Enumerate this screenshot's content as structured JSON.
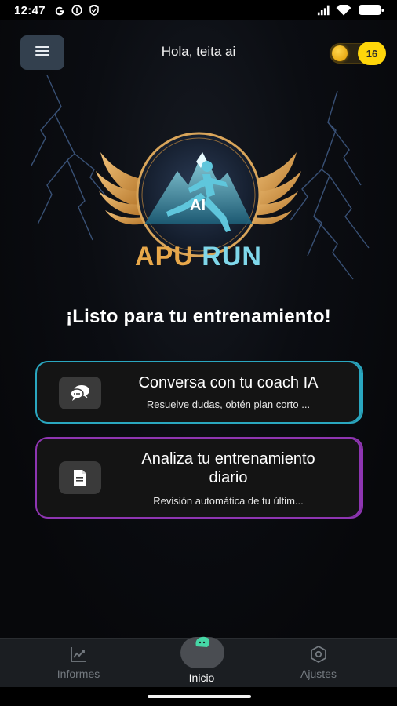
{
  "status_bar": {
    "time": "12:47",
    "left_icons": [
      "google-icon",
      "info-icon",
      "shield-icon"
    ],
    "right_icons": [
      "signal-icon",
      "wifi-icon",
      "battery-icon"
    ]
  },
  "header": {
    "menu_icon": "hamburger-icon",
    "greeting": "Hola, teita ai",
    "coins": "16"
  },
  "logo": {
    "badge_text": "AI",
    "brand_part1": "APU",
    "brand_part2": "RUN"
  },
  "headline": "¡Listo para tu entrenamiento!",
  "cards": [
    {
      "icon": "chat-bubbles-icon",
      "title": "Conversa con tu coach IA",
      "subtitle": "Resuelve dudas, obtén plan corto ...",
      "accent": "#2aa7c0"
    },
    {
      "icon": "document-icon",
      "title_line1": "Analiza tu entrenamiento",
      "title_line2": "diario",
      "subtitle": "Revisión automática de tu últim...",
      "accent": "#8e35b2"
    }
  ],
  "bottom_nav": {
    "items": [
      {
        "label": "Informes",
        "icon": "chart-icon",
        "active": false
      },
      {
        "label": "Inicio",
        "icon": "home-icon",
        "active": true
      },
      {
        "label": "Ajustes",
        "icon": "settings-hexagon-icon",
        "active": false
      }
    ]
  },
  "colors": {
    "background": "#07080b",
    "coin_badge": "#ffd60a",
    "brand_gold": "#e8a84a",
    "brand_cyan": "#7fd7ea"
  }
}
